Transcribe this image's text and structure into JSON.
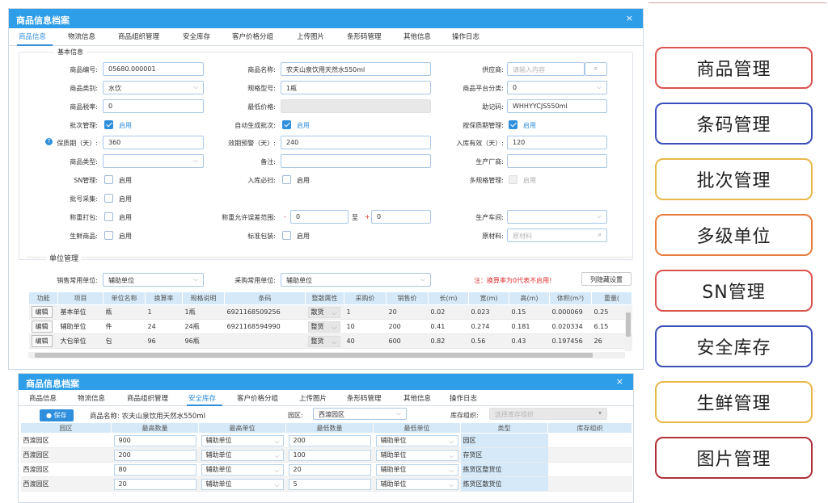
{
  "window1": {
    "title": "商品信息档案",
    "close": "×",
    "tabs": [
      "商品信息",
      "物流信息",
      "商品组织管理",
      "安全库存",
      "客户价格分组",
      "上传图片",
      "条形码管理",
      "其他信息",
      "操作日志"
    ],
    "section_basic": "基本信息",
    "fields": {
      "code_label": "商品编号:",
      "code_value": "05680.000001",
      "name_label": "商品名称:",
      "name_value": "农夫山泉饮用天然水550ml",
      "supplier_label": "供应商:",
      "supplier_placeholder": "请输入内容",
      "category_label": "商品类别:",
      "category_value": "水饮",
      "spec_label": "规格型号:",
      "spec_value": "1瓶",
      "platform_label": "商品平台分类:",
      "platform_value": "0",
      "tax_label": "商品税率:",
      "tax_value": "0",
      "minprice_label": "最低价格:",
      "mnemonic_label": "助记码:",
      "mnemonic_value": "WHHYYCJS550ml",
      "batch_label": "批次管理:",
      "batch_text": "启用",
      "autobatch_label": "自动生成批次:",
      "autobatch_text": "启用",
      "expiry_mgmt_label": "按保质期管理:",
      "expiry_mgmt_text": "启用",
      "shelf_label": "保质期（天）:",
      "shelf_value": "360",
      "warn_label": "效期预警（天）:",
      "warn_value": "240",
      "instock_label": "入库有效（天）:",
      "instock_value": "120",
      "type_label": "商品类型:",
      "remark_label": "备注:",
      "maker_label": "生产厂商:",
      "sn_label": "SN管理:",
      "sn_text": "启用",
      "scan_label": "入库必扫:",
      "scan_text": "启用",
      "multispec_label": "多规格管理:",
      "multispec_text": "启用",
      "batchcol_label": "批号采集:",
      "batchcol_text": "启用",
      "weigh_label": "称重打包:",
      "weigh_text": "启用",
      "tolerance_label": "称重允许误差范围:",
      "tol_minus": "-",
      "tol_from": "0",
      "tol_to": "至",
      "tol_plus": "+",
      "tol_to_value": "0",
      "workshop_label": "生产车间:",
      "fresh_label": "生鲜商品:",
      "fresh_text": "启用",
      "std_label": "标准包装:",
      "std_text": "启用",
      "material_label": "原材料:",
      "material_placeholder": "原材料"
    },
    "section_unit": "单位管理",
    "sale_unit_label": "销售常用单位:",
    "sale_unit_value": "辅助单位",
    "buy_unit_label": "采购常用单位:",
    "buy_unit_value": "辅助单位",
    "note": "注：换算率为0代表不启用!",
    "col_hide_button": "列隐藏设置",
    "unit_table": {
      "headers": [
        "功能",
        "项目",
        "单位名称",
        "换算率",
        "规格说明",
        "条码",
        "整散属性",
        "采购价",
        "销售价",
        "长(m)",
        "宽(m)",
        "高(m)",
        "体积(m³)",
        "重量("
      ],
      "rows": [
        [
          "编辑",
          "基本单位",
          "瓶",
          "1",
          "1瓶",
          "6921168509256",
          "散货",
          "1",
          "20",
          "0.02",
          "0.023",
          "0.15",
          "0.000069",
          "0.25"
        ],
        [
          "编辑",
          "辅助单位",
          "件",
          "24",
          "24瓶",
          "6921168594990",
          "整货",
          "10",
          "200",
          "0.41",
          "0.274",
          "0.181",
          "0.020334",
          "6.15"
        ],
        [
          "编辑",
          "大包单位",
          "包",
          "96",
          "96瓶",
          "",
          "整货",
          "40",
          "600",
          "0.82",
          "0.56",
          "0.43",
          "0.197456",
          "26"
        ]
      ]
    }
  },
  "window2": {
    "title": "商品信息档案",
    "close": "×",
    "tabs": [
      "商品信息",
      "物流信息",
      "商品组织管理",
      "安全库存",
      "客户价格分组",
      "上传图片",
      "条形码管理",
      "其他信息",
      "操作日志"
    ],
    "save": "保存",
    "product_label": "商品名称: 农夫山泉饮用天然水550ml",
    "zone_label": "园区:",
    "zone_value": "西渡园区",
    "org_label": "库存组织:",
    "org_placeholder": "选择库存组织",
    "headers": [
      "园区",
      "最高数量",
      "最高单位",
      "最低数量",
      "最低单位",
      "类型",
      "库存组织"
    ],
    "rows": [
      [
        "西渡园区",
        "900",
        "辅助单位",
        "200",
        "辅助单位",
        "园区",
        ""
      ],
      [
        "西渡园区",
        "200",
        "辅助单位",
        "100",
        "辅助单位",
        "存货区",
        ""
      ],
      [
        "西渡园区",
        "80",
        "辅助单位",
        "20",
        "辅助单位",
        "拣货区整货位",
        ""
      ],
      [
        "西渡园区",
        "20",
        "辅助单位",
        "5",
        "辅助单位",
        "拣货区散货位",
        ""
      ]
    ]
  },
  "categories": [
    {
      "label": "商品管理",
      "color": "#d9534f"
    },
    {
      "label": "条码管理",
      "color": "#3b4fb8"
    },
    {
      "label": "批次管理",
      "color": "#e8b84a"
    },
    {
      "label": "多级单位",
      "color": "#e87d3e"
    },
    {
      "label": "SN管理",
      "color": "#d9534f"
    },
    {
      "label": "安全库存",
      "color": "#3b4fb8"
    },
    {
      "label": "生鲜管理",
      "color": "#e8b84a"
    },
    {
      "label": "图片管理",
      "color": "#b0303a"
    }
  ]
}
